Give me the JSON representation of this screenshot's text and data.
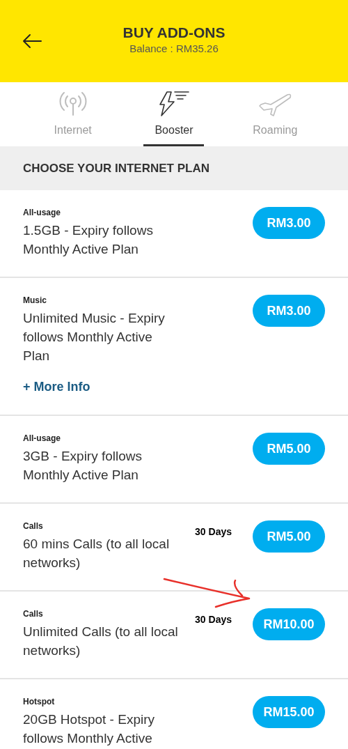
{
  "header": {
    "title": "BUY ADD-ONS",
    "balance": "Balance : RM35.26"
  },
  "tabs": [
    {
      "label": "Internet",
      "kind": "antenna",
      "selected": false
    },
    {
      "label": "Booster",
      "kind": "bolt",
      "selected": true
    },
    {
      "label": "Roaming",
      "kind": "plane",
      "selected": false
    }
  ],
  "section_title": "CHOOSE YOUR INTERNET PLAN",
  "plans": [
    {
      "category": "All-usage",
      "description": "1.5GB - Expiry follows Monthly Active Plan",
      "price": "RM3.00"
    },
    {
      "category": "Music",
      "description": "Unlimited Music - Expiry follows Monthly Active Plan",
      "price": "RM3.00",
      "more_info": "+ More Info"
    },
    {
      "category": "All-usage",
      "description": "3GB - Expiry follows Monthly Active Plan",
      "price": "RM5.00"
    },
    {
      "category": "Calls",
      "description": "60 mins Calls (to all local networks)",
      "price": "RM5.00",
      "validity": "30 Days"
    },
    {
      "category": "Calls",
      "description": "Unlimited Calls (to all local networks)",
      "price": "RM10.00",
      "validity": "30 Days"
    },
    {
      "category": "Hotspot",
      "description": "20GB Hotspot - Expiry follows Monthly Active",
      "price": "RM15.00"
    }
  ]
}
